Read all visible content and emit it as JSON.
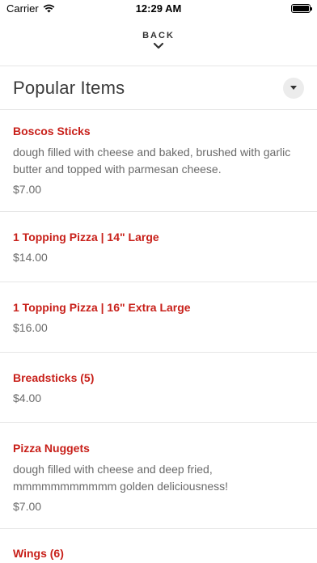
{
  "status_bar": {
    "carrier": "Carrier",
    "time": "12:29 AM",
    "battery_level": 1.0
  },
  "nav": {
    "back_label": "BACK"
  },
  "section": {
    "title": "Popular Items"
  },
  "items": [
    {
      "name": "Boscos Sticks",
      "description": "dough filled with cheese and baked, brushed with garlic butter and topped with parmesan cheese.",
      "price": "$7.00"
    },
    {
      "name": "1 Topping Pizza | 14\" Large",
      "description": "",
      "price": "$14.00"
    },
    {
      "name": "1 Topping Pizza | 16\" Extra Large",
      "description": "",
      "price": "$16.00"
    },
    {
      "name": "Breadsticks (5)",
      "description": "",
      "price": "$4.00"
    },
    {
      "name": "Pizza Nuggets",
      "description": "dough filled with cheese and deep fried, mmmmmmmmmmm golden deliciousness!",
      "price": "$7.00"
    },
    {
      "name": "Wings (6)",
      "description": "",
      "price": ""
    }
  ],
  "colors": {
    "accent": "#c8201a",
    "text": "#3a3a3a",
    "muted": "#6a6a6a",
    "divider": "#e6e6e6"
  }
}
